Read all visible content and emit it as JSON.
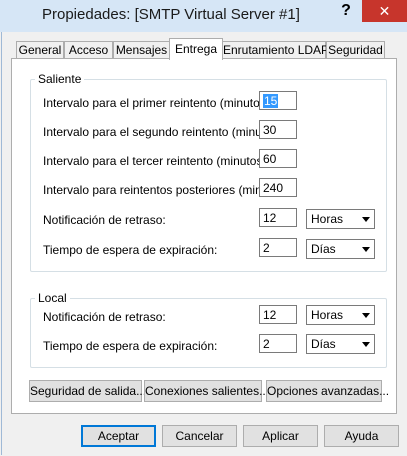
{
  "window": {
    "title": "Propiedades: [SMTP Virtual Server #1]",
    "help_glyph": "?",
    "close_glyph": "✕"
  },
  "tabs": [
    "General",
    "Acceso",
    "Mensajes",
    "Entrega",
    "Enrutamiento LDAP",
    "Seguridad"
  ],
  "active_tab": "Entrega",
  "saliente": {
    "legend": "Saliente",
    "first_retry_label": "Intervalo para el primer reintento (minutos):",
    "first_retry_value": "15",
    "second_retry_label": "Intervalo para el segundo reintento (minutos):",
    "second_retry_value": "30",
    "third_retry_label": "Intervalo para el tercer reintento (minutos):",
    "third_retry_value": "60",
    "subsequent_retry_label": "Intervalo para reintentos posteriores (minutos):",
    "subsequent_retry_value": "240",
    "delay_notification_label": "Notificación de retraso:",
    "delay_notification_value": "12",
    "delay_notification_unit": "Horas",
    "expiration_timeout_label": "Tiempo de espera de expiración:",
    "expiration_timeout_value": "2",
    "expiration_timeout_unit": "Días"
  },
  "local": {
    "legend": "Local",
    "delay_notification_label": "Notificación de retraso:",
    "delay_notification_value": "12",
    "delay_notification_unit": "Horas",
    "expiration_timeout_label": "Tiempo de espera de expiración:",
    "expiration_timeout_value": "2",
    "expiration_timeout_unit": "Días"
  },
  "panel_buttons": {
    "outbound_security": "Seguridad de salida...",
    "outbound_connections": "Conexiones salientes...",
    "advanced": "Opciones avanzadas..."
  },
  "dialog_buttons": {
    "ok": "Aceptar",
    "cancel": "Cancelar",
    "apply": "Aplicar",
    "help": "Ayuda"
  }
}
